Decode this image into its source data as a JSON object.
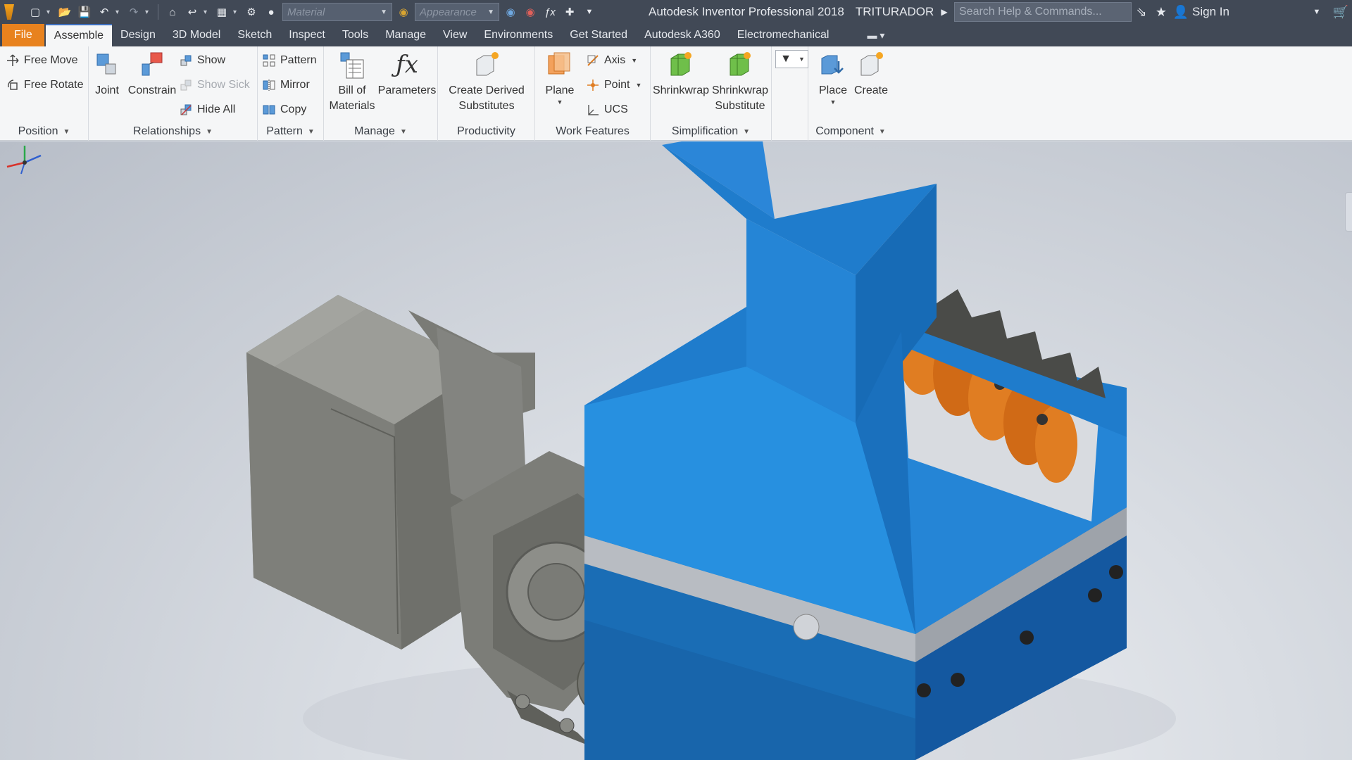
{
  "titlebar": {
    "app_title": "Autodesk Inventor Professional 2018",
    "document": "TRITURADOR",
    "material_placeholder": "Material",
    "appearance_placeholder": "Appearance",
    "search_placeholder": "Search Help & Commands...",
    "sign_in": "Sign In"
  },
  "tabs": {
    "file": "File",
    "assemble": "Assemble",
    "design": "Design",
    "model3d": "3D Model",
    "sketch": "Sketch",
    "inspect": "Inspect",
    "tools": "Tools",
    "manage": "Manage",
    "view": "View",
    "environments": "Environments",
    "get_started": "Get Started",
    "a360": "Autodesk A360",
    "electromechanical": "Electromechanical"
  },
  "ribbon": {
    "position": {
      "label": "Position",
      "free_move": "Free Move",
      "free_rotate": "Free Rotate"
    },
    "relationships": {
      "label": "Relationships",
      "joint": "Joint",
      "constrain": "Constrain",
      "show": "Show",
      "show_sick": "Show Sick",
      "hide_all": "Hide All"
    },
    "pattern": {
      "label": "Pattern",
      "pattern": "Pattern",
      "mirror": "Mirror",
      "copy": "Copy"
    },
    "manage": {
      "label": "Manage",
      "bom_line1": "Bill of",
      "bom_line2": "Materials",
      "parameters": "Parameters"
    },
    "productivity": {
      "label": "Productivity",
      "cds_line1": "Create Derived",
      "cds_line2": "Substitutes"
    },
    "work_features": {
      "label": "Work Features",
      "plane": "Plane",
      "axis": "Axis",
      "point": "Point",
      "ucs": "UCS"
    },
    "simplification": {
      "label": "Simplification",
      "shrinkwrap": "Shrinkwrap",
      "sws_line1": "Shrinkwrap",
      "sws_line2": "Substitute"
    },
    "component": {
      "label": "Component",
      "place": "Place",
      "create": "Create"
    }
  },
  "colors": {
    "titlebar_bg": "#414956",
    "file_tab": "#e8821e",
    "hopper_blue": "#1f7ccc",
    "motor_gray": "#8a8b86",
    "coupling_orange": "#e07d22"
  },
  "icons": [
    "new-icon",
    "open-icon",
    "save-icon",
    "undo-icon",
    "redo-icon",
    "home-icon",
    "return-icon",
    "select-icon",
    "globe-icon",
    "appearance-icon",
    "clear-appearance-icon",
    "function-icon",
    "plus-icon",
    "cart-icon",
    "help-icon",
    "star-icon",
    "user-icon"
  ]
}
